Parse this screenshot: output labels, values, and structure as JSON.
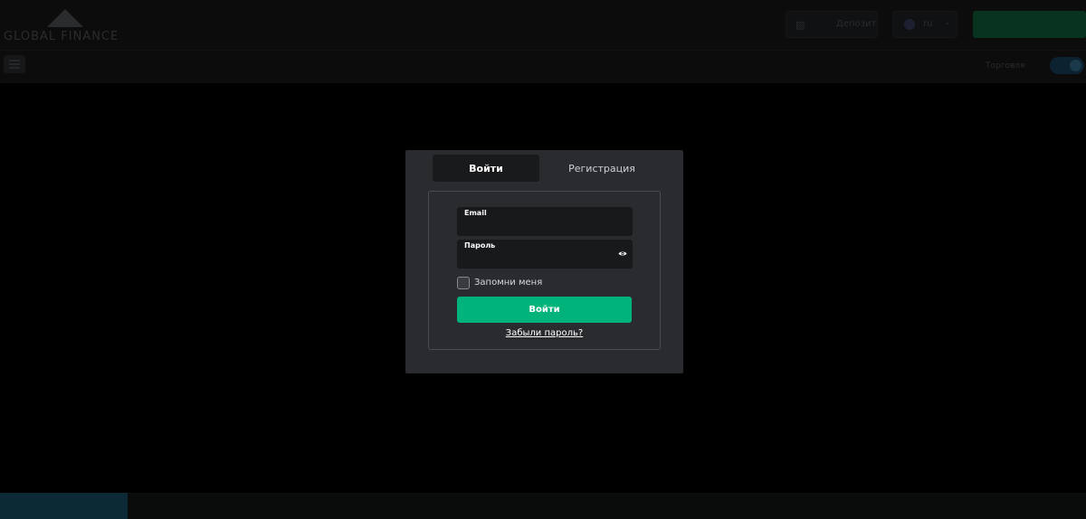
{
  "background": {
    "logo_text": "GLOBAL FINANCE",
    "deposit_label": "Депозит",
    "deposit_icon": "wallet-icon",
    "language": "ru",
    "toggle_label": "Торговля",
    "menu_icon": "hamburger-icon"
  },
  "tabs": {
    "login": "Войти",
    "register": "Регистрация"
  },
  "form": {
    "email_label": "Email",
    "email_value": "",
    "password_label": "Пароль",
    "password_value": "",
    "password_toggle_icon": "eye-icon",
    "remember_label": "Запомни меня",
    "remember_checked": false,
    "submit_label": "Войти",
    "forgot_link": "Забыли пароль?"
  },
  "colors": {
    "modal_bg": "#2a2b2f",
    "accent": "#00b37a",
    "field_bg": "#18191b",
    "active_tab_bg": "#191a1c"
  }
}
